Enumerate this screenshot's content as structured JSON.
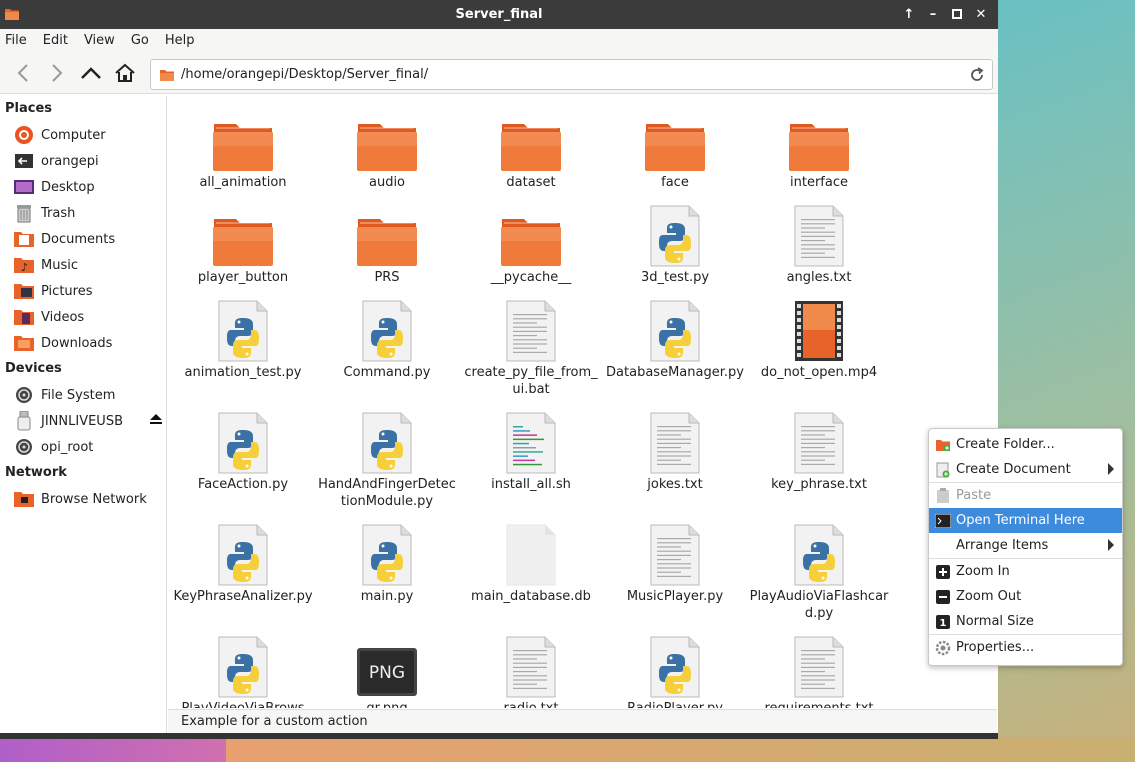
{
  "window": {
    "title": "Server_final"
  },
  "menubar": [
    "File",
    "Edit",
    "View",
    "Go",
    "Help"
  ],
  "toolbar": {
    "path": "/home/orangepi/Desktop/Server_final/"
  },
  "sidebar": {
    "places_heading": "Places",
    "places": [
      {
        "label": "Computer",
        "icon": "computer-icon"
      },
      {
        "label": "orangepi",
        "icon": "home-folder-icon"
      },
      {
        "label": "Desktop",
        "icon": "desktop-icon"
      },
      {
        "label": "Trash",
        "icon": "trash-icon"
      },
      {
        "label": "Documents",
        "icon": "documents-folder-icon"
      },
      {
        "label": "Music",
        "icon": "music-folder-icon"
      },
      {
        "label": "Pictures",
        "icon": "pictures-folder-icon"
      },
      {
        "label": "Videos",
        "icon": "videos-folder-icon"
      },
      {
        "label": "Downloads",
        "icon": "downloads-folder-icon"
      }
    ],
    "devices_heading": "Devices",
    "devices": [
      {
        "label": "File System",
        "icon": "drive-icon"
      },
      {
        "label": "JINNLIVEUSB",
        "icon": "usb-icon"
      },
      {
        "label": "opi_root",
        "icon": "drive-icon"
      }
    ],
    "network_heading": "Network",
    "network": [
      {
        "label": "Browse Network",
        "icon": "network-icon"
      }
    ]
  },
  "files": [
    {
      "name": "all_animation",
      "type": "folder"
    },
    {
      "name": "audio",
      "type": "folder"
    },
    {
      "name": "dataset",
      "type": "folder"
    },
    {
      "name": "face",
      "type": "folder"
    },
    {
      "name": "interface",
      "type": "folder"
    },
    {
      "name": "player_button",
      "type": "folder"
    },
    {
      "name": "PRS",
      "type": "folder"
    },
    {
      "name": "__pycache__",
      "type": "folder"
    },
    {
      "name": "3d_test.py",
      "type": "python"
    },
    {
      "name": "angles.txt",
      "type": "text"
    },
    {
      "name": "animation_test.py",
      "type": "python"
    },
    {
      "name": "Command.py",
      "type": "python"
    },
    {
      "name": "create_py_file_from_ui.bat",
      "type": "text"
    },
    {
      "name": "DatabaseManager.py",
      "type": "python"
    },
    {
      "name": "do_not_open.mp4",
      "type": "video"
    },
    {
      "name": "FaceAction.py",
      "type": "python"
    },
    {
      "name": "HandAndFingerDetectionModule.py",
      "type": "python"
    },
    {
      "name": "install_all.sh",
      "type": "script"
    },
    {
      "name": "jokes.txt",
      "type": "text"
    },
    {
      "name": "key_phrase.txt",
      "type": "text"
    },
    {
      "name": "KeyPhraseAnalizer.py",
      "type": "python"
    },
    {
      "name": "main.py",
      "type": "python"
    },
    {
      "name": "main_database.db",
      "type": "blank"
    },
    {
      "name": "MusicPlayer.py",
      "type": "text"
    },
    {
      "name": "PlayAudioViaFlashcard.py",
      "type": "python"
    },
    {
      "name": "PlayVideoViaBrows",
      "type": "python"
    },
    {
      "name": "qr.png",
      "type": "png"
    },
    {
      "name": "radio.txt",
      "type": "text"
    },
    {
      "name": "RadioPlayer.py",
      "type": "python"
    },
    {
      "name": "requirements.txt",
      "type": "text"
    }
  ],
  "status": {
    "text": "Example for a custom action"
  },
  "context_menu": [
    {
      "label": "Create Folder...",
      "icon": "new-folder-icon",
      "state": "normal",
      "submenu": false
    },
    {
      "label": "Create Document",
      "icon": "new-document-icon",
      "state": "normal",
      "submenu": true
    },
    {
      "sep": true
    },
    {
      "label": "Paste",
      "icon": "paste-icon",
      "state": "disabled",
      "submenu": false
    },
    {
      "label": "Open Terminal Here",
      "icon": "terminal-icon",
      "state": "active",
      "submenu": false
    },
    {
      "label": "Arrange Items",
      "icon": "",
      "state": "normal",
      "submenu": true
    },
    {
      "sep": true
    },
    {
      "label": "Zoom In",
      "icon": "zoom-in-icon",
      "state": "normal",
      "submenu": false
    },
    {
      "label": "Zoom Out",
      "icon": "zoom-out-icon",
      "state": "normal",
      "submenu": false
    },
    {
      "label": "Normal Size",
      "icon": "normal-size-icon",
      "state": "normal",
      "submenu": false
    },
    {
      "sep": true
    },
    {
      "label": "Properties...",
      "icon": "properties-icon",
      "state": "normal",
      "submenu": false
    }
  ],
  "colors": {
    "folder": "#e8632a",
    "accent": "#3d8bdc",
    "titlebar": "#3b3b3b"
  }
}
